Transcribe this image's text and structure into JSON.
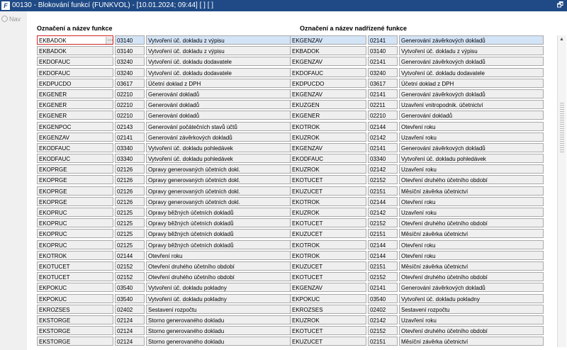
{
  "window": {
    "title": "00130 - Blokování funkcí (FUNKVOL) - [10.01.2024; 09:44]  [ ] [ ]",
    "logo": "F",
    "restore_glyph": "🗗"
  },
  "nav": {
    "label": "Nav"
  },
  "left": {
    "header": "Označení a název funkce",
    "rows": [
      [
        "EKBADOK",
        "03140",
        "Vytvoření úč. dokladu z výpisu"
      ],
      [
        "EKBADOK",
        "03140",
        "Vytvoření úč. dokladu z výpisu"
      ],
      [
        "EKDOFAUC",
        "03240",
        "Vytvoření úč. dokladu dodavatele"
      ],
      [
        "EKDOFAUC",
        "03240",
        "Vytvoření úč. dokladu dodavatele"
      ],
      [
        "EKDPUCDO",
        "03617",
        "Účetní doklad z DPH"
      ],
      [
        "EKGENER",
        "02210",
        "Generování dokladů"
      ],
      [
        "EKGENER",
        "02210",
        "Generování dokladů"
      ],
      [
        "EKGENER",
        "02210",
        "Generování dokladů"
      ],
      [
        "EKGENPOC",
        "02143",
        "Generování počátečních stavů účtů"
      ],
      [
        "EKGENZAV",
        "02141",
        "Generování závěrkových dokladů"
      ],
      [
        "EKODFAUC",
        "03340",
        "Vytvoření úč. dokladu pohledávek"
      ],
      [
        "EKODFAUC",
        "03340",
        "Vytvoření úč. dokladu pohledávek"
      ],
      [
        "EKOPRGE",
        "02126",
        "Opravy generovaných účetních dokl."
      ],
      [
        "EKOPRGE",
        "02126",
        "Opravy generovaných účetních dokl."
      ],
      [
        "EKOPRGE",
        "02126",
        "Opravy generovaných účetních dokl."
      ],
      [
        "EKOPRGE",
        "02126",
        "Opravy generovaných účetních dokl."
      ],
      [
        "EKOPRUC",
        "02125",
        "Opravy běžných účetních dokladů"
      ],
      [
        "EKOPRUC",
        "02125",
        "Opravy běžných účetních dokladů"
      ],
      [
        "EKOPRUC",
        "02125",
        "Opravy běžných účetních dokladů"
      ],
      [
        "EKOPRUC",
        "02125",
        "Opravy běžných účetních dokladů"
      ],
      [
        "EKOTROK",
        "02144",
        "Otevření roku"
      ],
      [
        "EKOTUCET",
        "02152",
        "Otevření druhého účetního období"
      ],
      [
        "EKOTUCET",
        "02152",
        "Otevření druhého účetního období"
      ],
      [
        "EKPOKUC",
        "03540",
        "Vytvoření úč. dokladu pokladny"
      ],
      [
        "EKPOKUC",
        "03540",
        "Vytvoření úč. dokladu pokladny"
      ],
      [
        "EKROZSES",
        "02402",
        "Sestavení rozpočtu"
      ],
      [
        "EKSTORGE",
        "02124",
        "Storno generovaného dokladu"
      ],
      [
        "EKSTORGE",
        "02124",
        "Storno generovaného dokladu"
      ],
      [
        "EKSTORGE",
        "02124",
        "Storno generovaného dokladu"
      ]
    ]
  },
  "right": {
    "header": "Označení a název nadřízené funkce",
    "rows": [
      [
        "EKGENZAV",
        "02141",
        "Generování závěrkových dokladů"
      ],
      [
        "EKBADOK",
        "03140",
        "Vytvoření úč. dokladu z výpisu"
      ],
      [
        "EKGENZAV",
        "02141",
        "Generování závěrkových dokladů"
      ],
      [
        "EKDOFAUC",
        "03240",
        "Vytvoření úč. dokladu dodavatele"
      ],
      [
        "EKDPUCDO",
        "03617",
        "Účetní doklad z DPH"
      ],
      [
        "EKGENZAV",
        "02141",
        "Generování závěrkových dokladů"
      ],
      [
        "EKUZGEN",
        "02211",
        "Uzavření vnitropodnik. účetnictví"
      ],
      [
        "EKGENER",
        "02210",
        "Generování dokladů"
      ],
      [
        "EKOTROK",
        "02144",
        "Otevření roku"
      ],
      [
        "EKUZROK",
        "02142",
        "Uzavření roku"
      ],
      [
        "EKGENZAV",
        "02141",
        "Generování závěrkových dokladů"
      ],
      [
        "EKODFAUC",
        "03340",
        "Vytvoření úč. dokladu pohledávek"
      ],
      [
        "EKUZROK",
        "02142",
        "Uzavření roku"
      ],
      [
        "EKOTUCET",
        "02152",
        "Otevření druhého účetního období"
      ],
      [
        "EKUZUCET",
        "02151",
        "Měsíční závěrka účetnictví"
      ],
      [
        "EKOTROK",
        "02144",
        "Otevření roku"
      ],
      [
        "EKUZROK",
        "02142",
        "Uzavření roku"
      ],
      [
        "EKOTUCET",
        "02152",
        "Otevření druhého účetního období"
      ],
      [
        "EKUZUCET",
        "02151",
        "Měsíční závěrka účetnictví"
      ],
      [
        "EKOTROK",
        "02144",
        "Otevření roku"
      ],
      [
        "EKOTROK",
        "02144",
        "Otevření roku"
      ],
      [
        "EKUZUCET",
        "02151",
        "Měsíční závěrka účetnictví"
      ],
      [
        "EKOTUCET",
        "02152",
        "Otevření druhého účetního období"
      ],
      [
        "EKGENZAV",
        "02141",
        "Generování závěrkových dokladů"
      ],
      [
        "EKPOKUC",
        "03540",
        "Vytvoření úč. dokladu pokladny"
      ],
      [
        "EKROZSES",
        "02402",
        "Sestavení rozpočtu"
      ],
      [
        "EKUZROK",
        "02142",
        "Uzavření roku"
      ],
      [
        "EKOTUCET",
        "02152",
        "Otevření druhého účetního období"
      ],
      [
        "EKUZUCET",
        "02151",
        "Měsíční závěrka účetnictví"
      ]
    ]
  }
}
